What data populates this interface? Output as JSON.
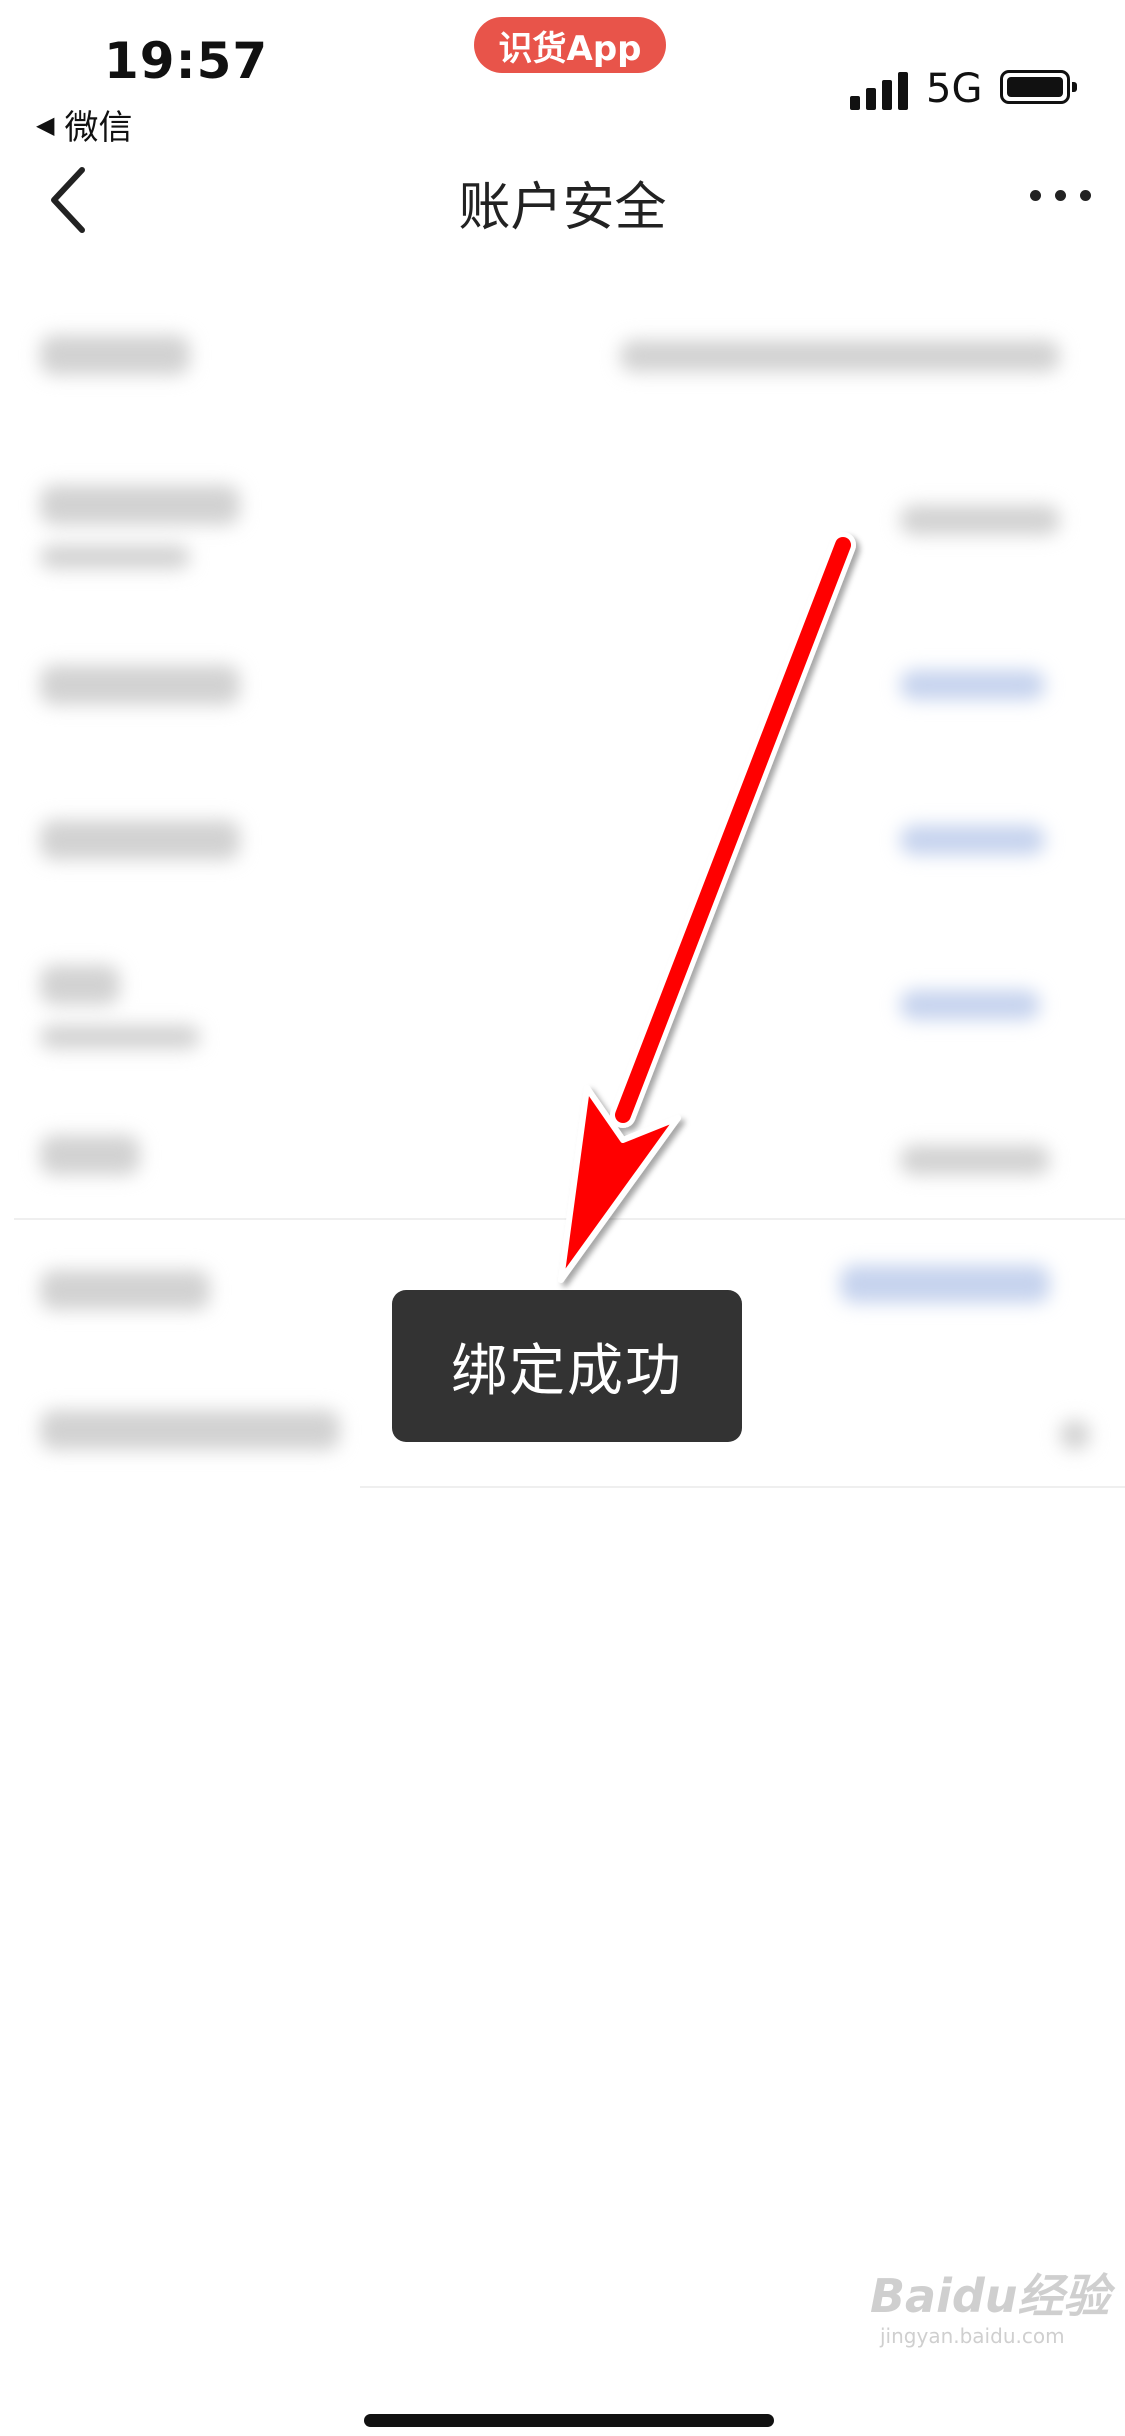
{
  "status_bar": {
    "time": "19:57",
    "network": "5G",
    "back_app": "微信"
  },
  "pill_label": "识货App",
  "nav": {
    "title": "账户安全",
    "back_icon": "chevron-left-icon",
    "more_icon": "more-dots-icon"
  },
  "toast": {
    "text": "绑定成功"
  },
  "annotation": {
    "color": "#ff0000"
  },
  "watermark": {
    "brand": "Baidu经验",
    "url": "jingyan.baidu.com"
  }
}
